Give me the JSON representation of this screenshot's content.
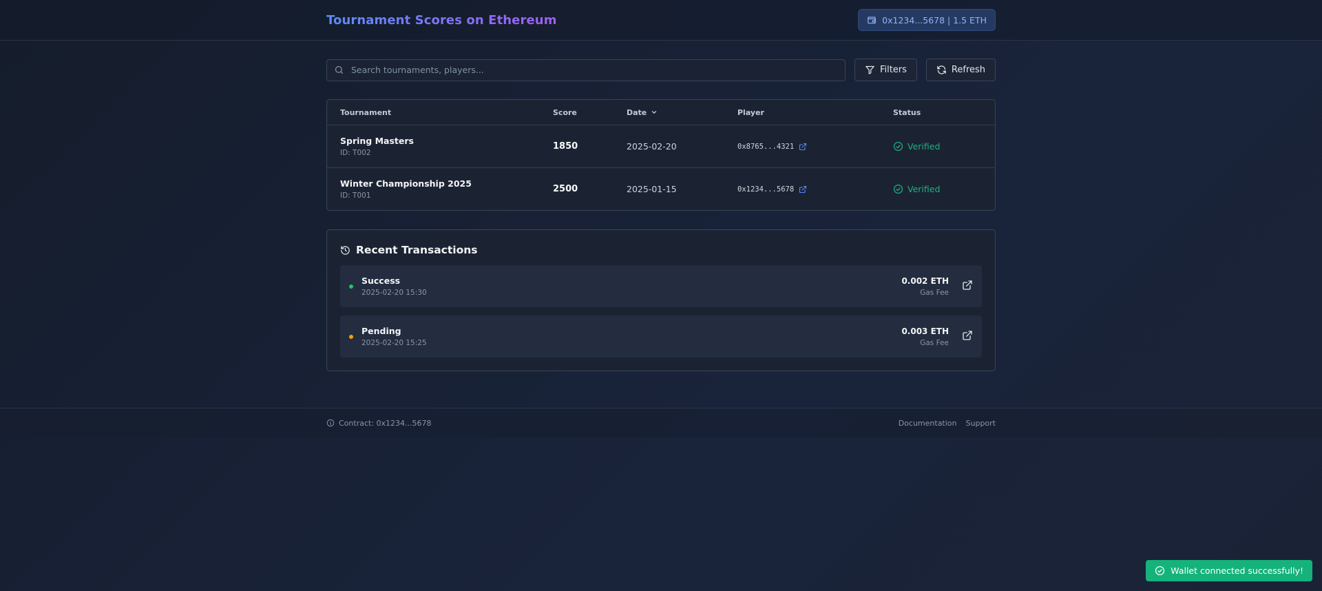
{
  "header": {
    "title": "Tournament Scores on Ethereum",
    "wallet_label": "0x1234...5678 | 1.5 ETH",
    "wallet_icon": "wallet-icon"
  },
  "toolbar": {
    "search_placeholder": "Search tournaments, players...",
    "filters_label": "Filters",
    "refresh_label": "Refresh"
  },
  "table": {
    "columns": [
      "Tournament",
      "Score",
      "Date",
      "Player",
      "Status"
    ],
    "rows": [
      {
        "name": "Spring Masters",
        "id": "ID: T002",
        "score": "1850",
        "date": "2025-02-20",
        "player": "0x8765...4321",
        "status": "Verified"
      },
      {
        "name": "Winter Championship 2025",
        "id": "ID: T001",
        "score": "2500",
        "date": "2025-01-15",
        "player": "0x1234...5678",
        "status": "Verified"
      }
    ]
  },
  "transactions": {
    "title": "Recent Transactions",
    "items": [
      {
        "status": "Success",
        "time": "2025-02-20 15:30",
        "amount": "0.002 ETH",
        "fee_label": "Gas Fee",
        "dot_color": "#22c55e"
      },
      {
        "status": "Pending",
        "time": "2025-02-20 15:25",
        "amount": "0.003 ETH",
        "fee_label": "Gas Fee",
        "dot_color": "#f59e0b"
      }
    ]
  },
  "footer": {
    "contract": "Contract: 0x1234...5678",
    "links": [
      "Documentation",
      "Support"
    ]
  },
  "toast": {
    "message": "Wallet connected successfully!"
  },
  "colors": {
    "accent_start": "#5b8cf5",
    "accent_end": "#a05ff0",
    "verified": "#22b07d",
    "toast_bg": "#15b27c"
  }
}
